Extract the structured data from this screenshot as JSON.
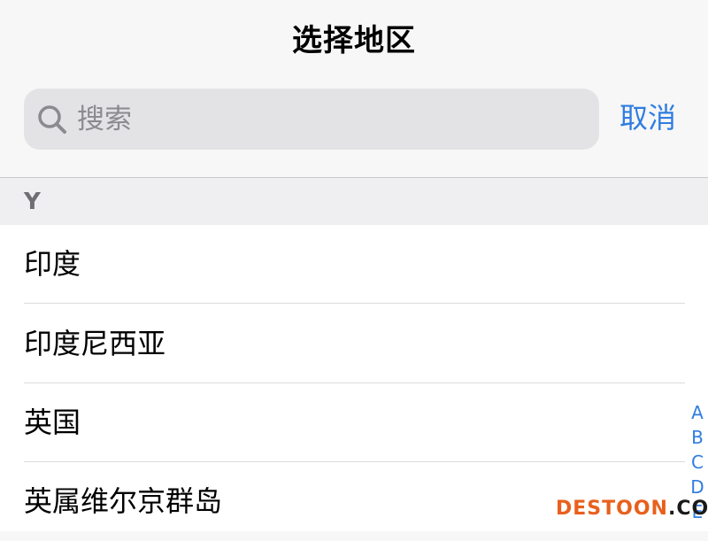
{
  "header": {
    "title": "选择地区"
  },
  "search": {
    "placeholder": "搜索",
    "cancel_label": "取消"
  },
  "section": {
    "letter": "Y"
  },
  "list": {
    "items": [
      {
        "label": "印度"
      },
      {
        "label": "印度尼西亚"
      },
      {
        "label": "英国"
      },
      {
        "label": "英属维尔京群岛"
      }
    ]
  },
  "index": {
    "letters": [
      "A",
      "B",
      "C",
      "D",
      "E"
    ]
  },
  "watermark": {
    "brand": "DESTOON",
    "suffix": ".COM"
  },
  "colors": {
    "accent": "#2f7de1",
    "watermark_accent": "#e8601c"
  },
  "icons": {
    "search": "search-icon"
  }
}
